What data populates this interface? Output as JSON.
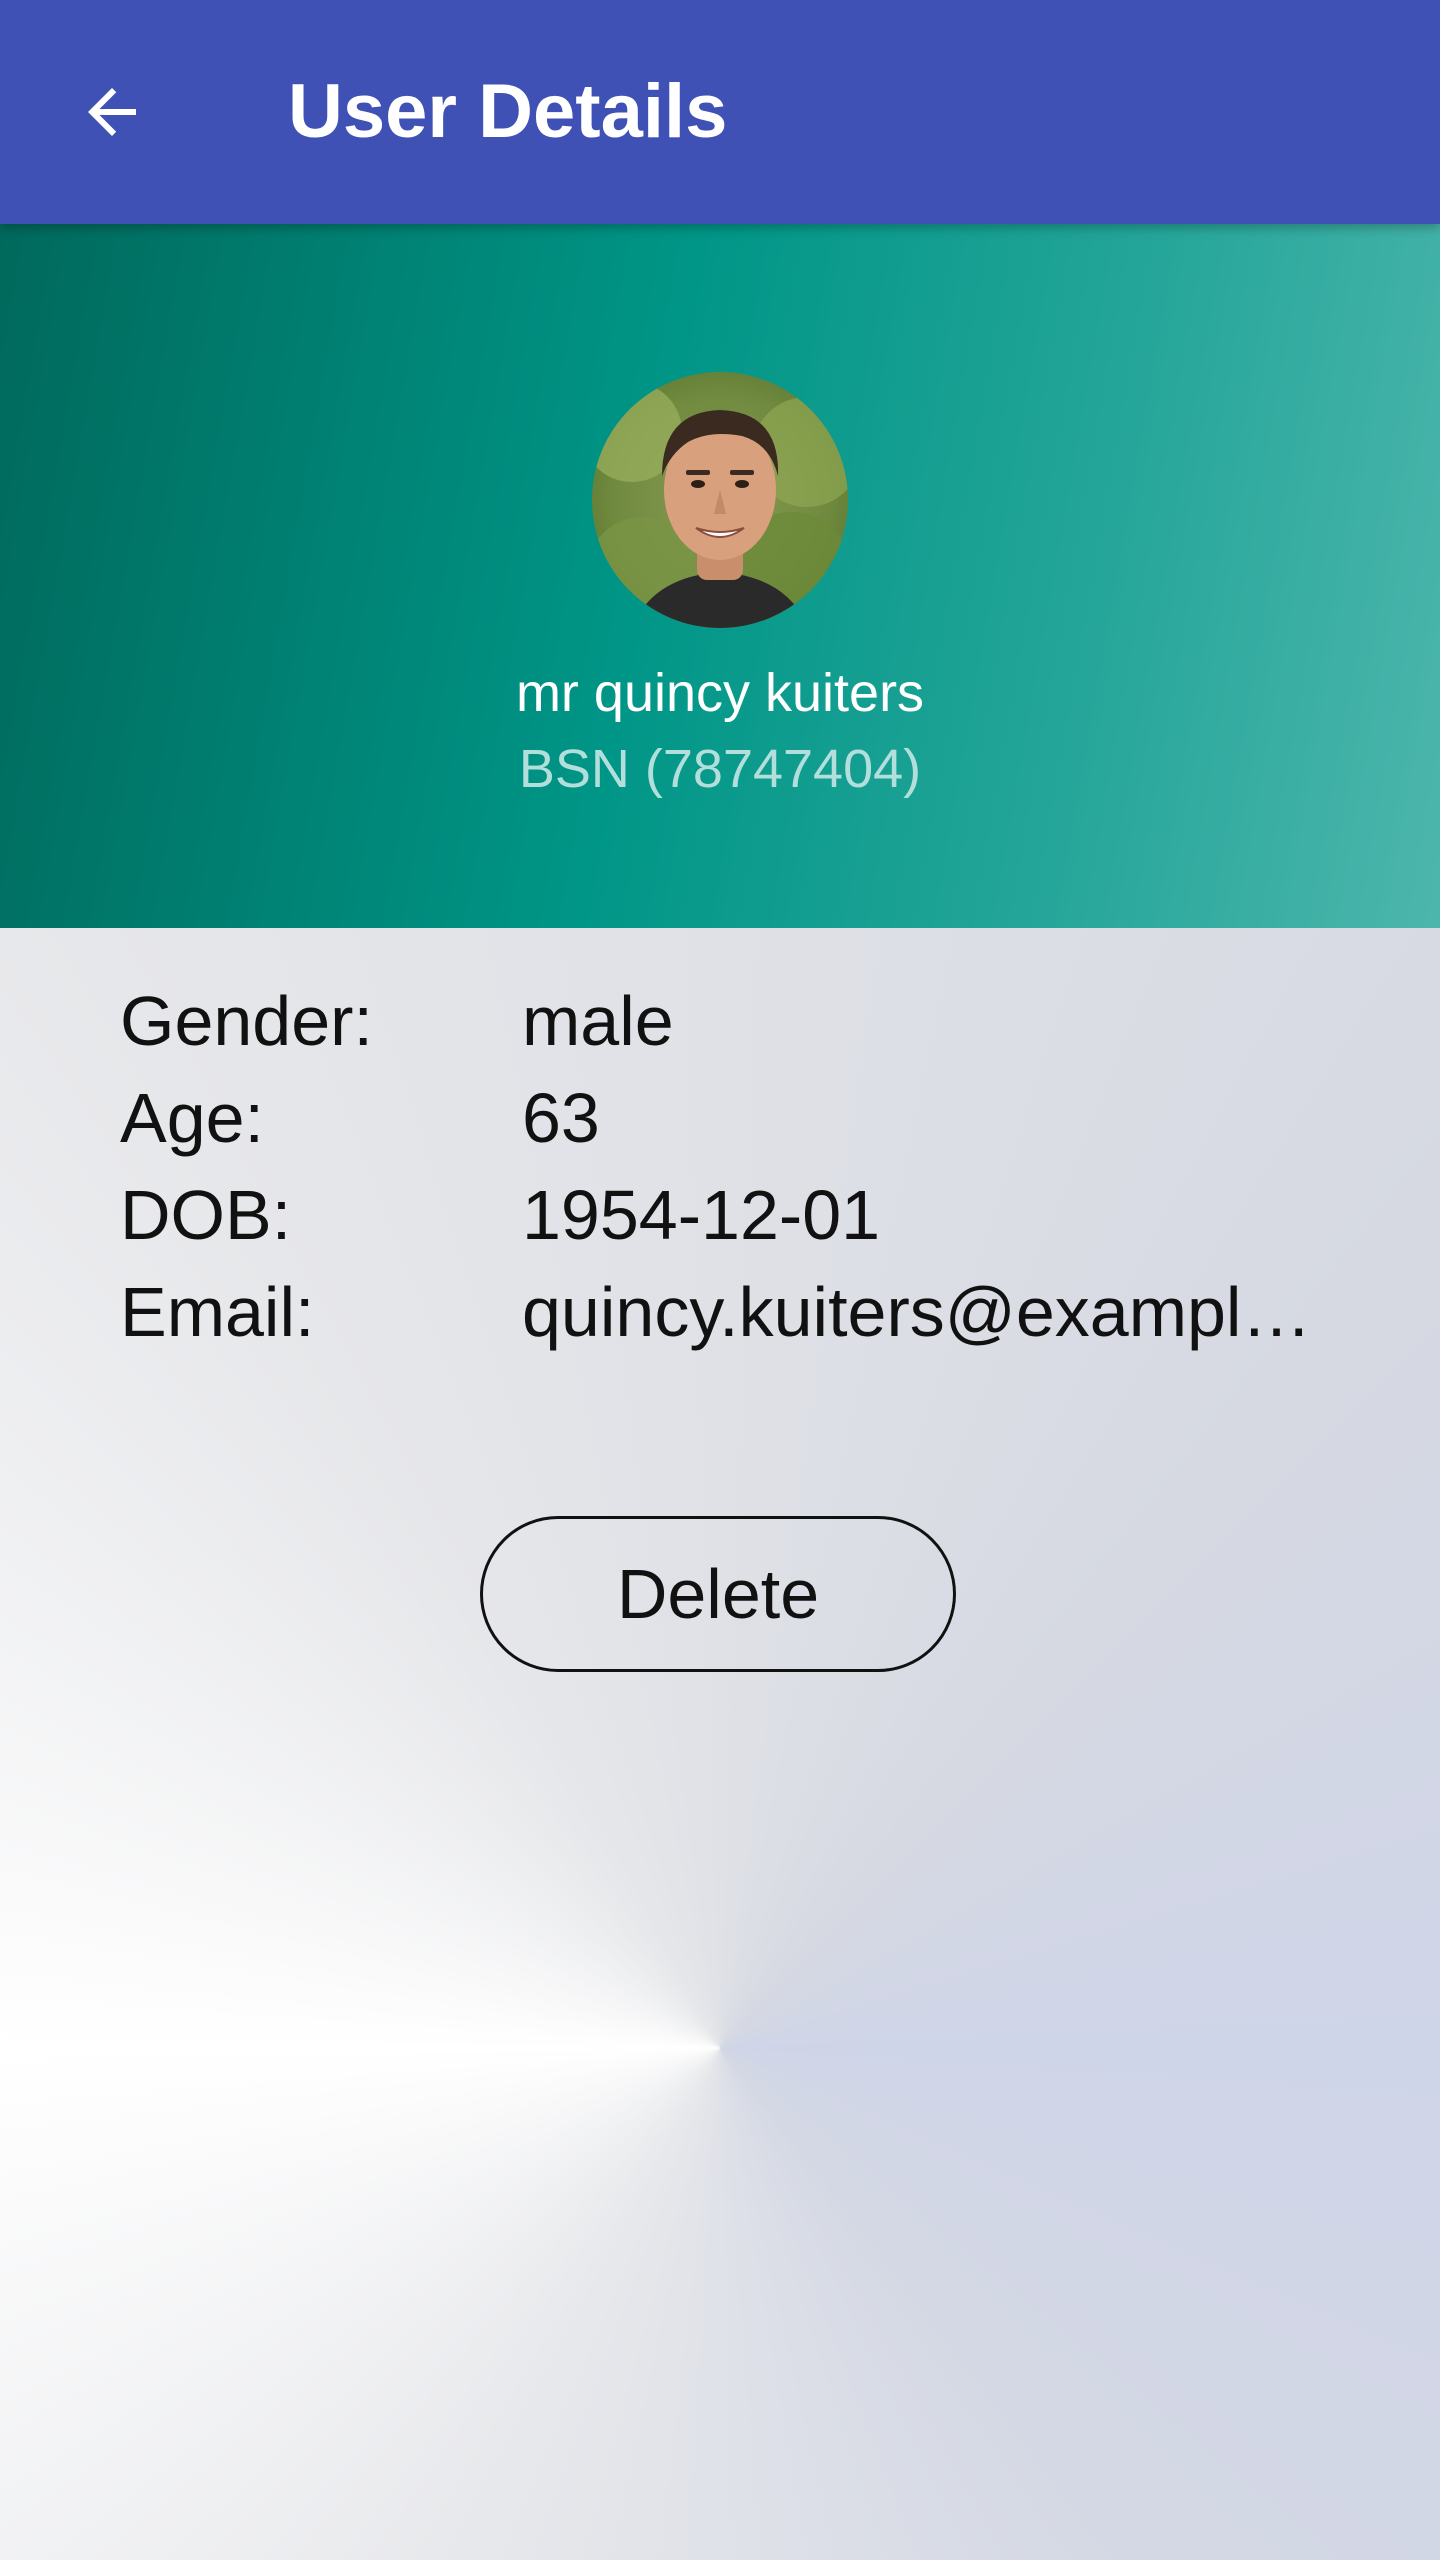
{
  "appbar": {
    "title": "User Details",
    "back_icon": "arrow-back-icon",
    "background": "#3f51b5"
  },
  "profile": {
    "name": "mr quincy kuiters",
    "bsn": "BSN (78747404)",
    "avatar": "user-avatar-photo"
  },
  "details": [
    {
      "label": "Gender:",
      "value": "male"
    },
    {
      "label": "Age:",
      "value": "63"
    },
    {
      "label": "DOB:",
      "value": "1954-12-01"
    },
    {
      "label": "Email:",
      "value": "quincy.kuiters@exampl…"
    }
  ],
  "actions": {
    "delete_label": "Delete"
  },
  "colors": {
    "header_gradient_start": "#00695c",
    "header_gradient_end": "#4db6ac",
    "bsn_text": "#b2dfdb"
  }
}
